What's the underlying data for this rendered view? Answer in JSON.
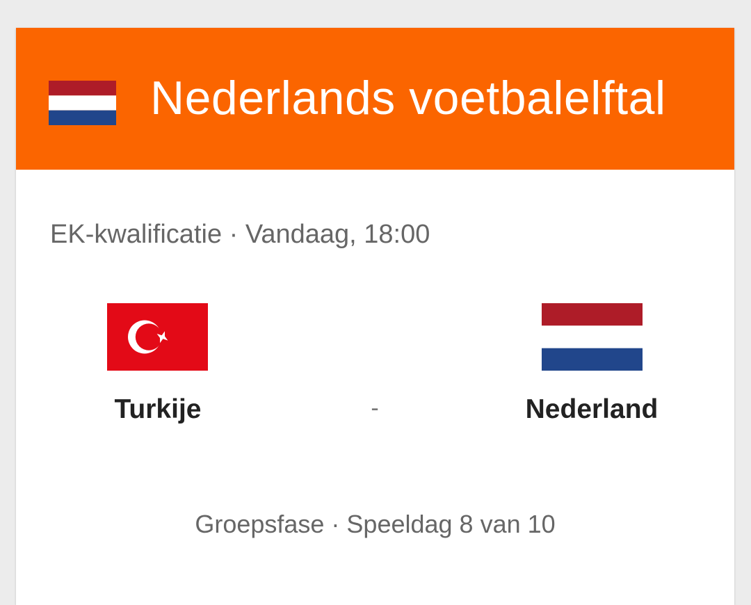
{
  "header": {
    "title": "Nederlands voetbalelftal",
    "flag_icon": "netherlands-flag-icon",
    "background_color": "#fb6500"
  },
  "match": {
    "meta": "EK-kwalificatie · Vandaag, 18:00",
    "home_team": {
      "name": "Turkije",
      "flag_icon": "turkey-flag-icon"
    },
    "separator": "-",
    "away_team": {
      "name": "Nederland",
      "flag_icon": "netherlands-flag-icon"
    },
    "stage": "Groepsfase · Speeldag 8 van 10"
  },
  "colors": {
    "nl_red": "#ae1c28",
    "nl_white": "#ffffff",
    "nl_blue": "#21468b",
    "tr_red": "#e30a17"
  }
}
